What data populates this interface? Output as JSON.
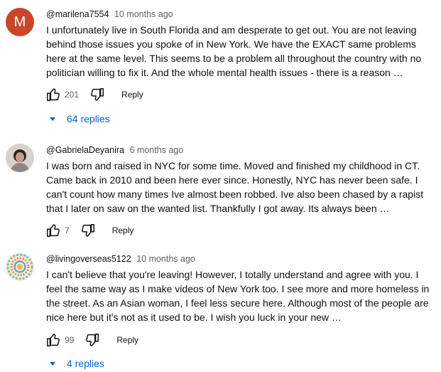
{
  "comments": [
    {
      "avatar_letter": "M",
      "author": "@marilena7554",
      "time": "10 months ago",
      "text": "I unfortunately live in South Florida and am desperate to get out. You are not leaving behind those issues you spoke of in New York. We have the EXACT same problems here at the same level. This seems to be a problem all throughout the country with no politician willing to fix it. And the whole mental health issues - there is a reason …",
      "likes": "201",
      "reply_label": "Reply",
      "replies_label": "64 replies"
    },
    {
      "author": "@GabrielaDeyanira",
      "time": "6 months ago",
      "text": "I was born and raised in NYC for some time. Moved and finished my childhood in CT. Came back in 2010 and been here ever since. Honestly, NYC has never been safe. I can't count how many times Ive almost been robbed. Ive also been chased by a rapist that I later on saw on the wanted list. Thankfully I got away. Its always been …",
      "likes": "7",
      "reply_label": "Reply"
    },
    {
      "author": "@livingoverseas5122",
      "time": "10 months ago",
      "text": "I can't believe that you're leaving! However, I totally understand and agree with you. I feel the same way as I make videos of New York too. I see more and more homeless in the street. As an Asian woman, I feel less secure here. Although most of the people are nice here but it's not as it used to be. I wish you luck in your new …",
      "likes": "99",
      "reply_label": "Reply",
      "replies_label": "4 replies"
    }
  ],
  "colors": {
    "avatar_m": "#c9452b",
    "link_blue": "#065fd4",
    "secondary_text": "#606060"
  },
  "icons": [
    "like-icon",
    "dislike-icon",
    "chevron-down-icon"
  ]
}
